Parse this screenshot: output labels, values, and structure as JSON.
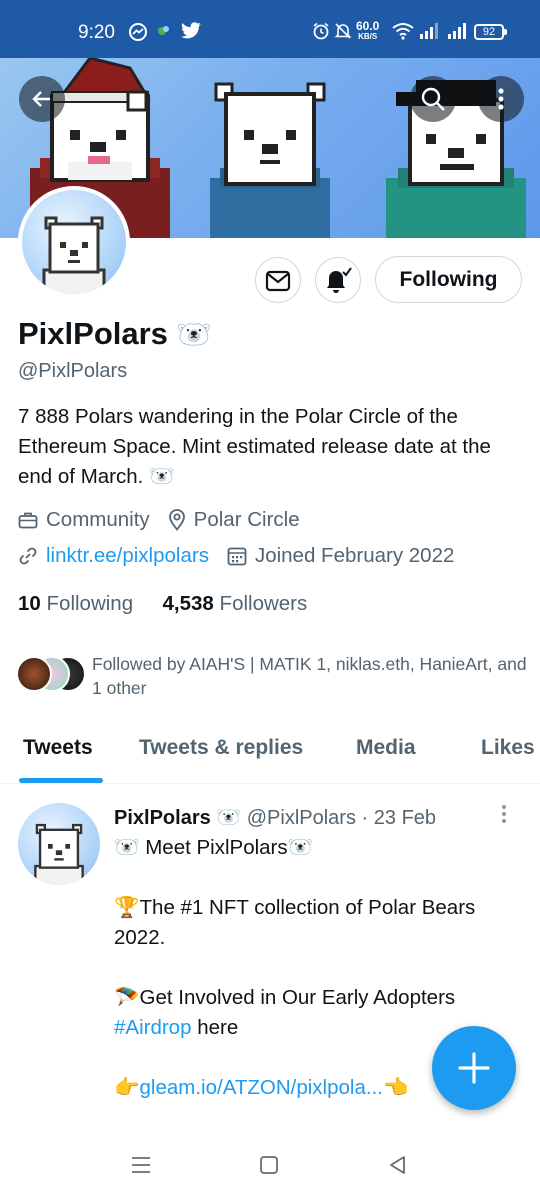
{
  "status_bar": {
    "time": "9:20",
    "speed_value": "60.0",
    "speed_unit": "KB/S",
    "battery": "92"
  },
  "profile": {
    "name": "PixlPolars",
    "name_emoji": "🐻‍❄️",
    "handle": "@PixlPolars",
    "bio": "7 888 Polars wandering in the Polar Circle of the Ethereum Space. Mint estimated release date at the end of March. 🐻‍❄️",
    "category": "Community",
    "location": "Polar Circle",
    "website": "linktr.ee/pixlpolars",
    "joined": "Joined February 2022",
    "following_count": "10",
    "following_label": "Following",
    "followers_count": "4,538",
    "followers_label": "Followers",
    "followed_by": "Followed by AIAH'S | MATIK 1, niklas.eth, HanieArt, and 1 other",
    "following_button": "Following"
  },
  "tabs": [
    {
      "label": "Tweets",
      "active": true
    },
    {
      "label": "Tweets & replies",
      "active": false
    },
    {
      "label": "Media",
      "active": false
    },
    {
      "label": "Likes",
      "active": false
    }
  ],
  "tweet": {
    "author_name": "PixlPolars",
    "author_emoji": "🐻‍❄️",
    "author_handle": "@PixlPolars",
    "separator": "·",
    "date": "23 Feb",
    "line1": "🐻‍❄️ Meet PixlPolars🐻‍❄️",
    "line2": "🏆The #1 NFT collection of Polar Bears 2022.",
    "line3_text": "🪂Get Involved in Our Early Adopters ",
    "line3_hashtag": "#Airdrop",
    "line3_after": " here",
    "line4_prefix": "👉",
    "line4_link": "gleam.io/ATZON/pixlpola...",
    "line4_suffix": "👈"
  },
  "colors": {
    "accent": "#1d9bf0",
    "status_bar": "#1f5aa6",
    "text_primary": "#0f1419",
    "text_secondary": "#536471"
  },
  "icons": {
    "back": "arrow-left-icon",
    "search": "search-icon",
    "more": "more-vertical-icon",
    "message": "envelope-icon",
    "notifications": "bell-check-icon",
    "category": "briefcase-icon",
    "location": "location-pin-icon",
    "website": "link-icon",
    "joined": "calendar-icon",
    "compose": "plus-icon"
  }
}
